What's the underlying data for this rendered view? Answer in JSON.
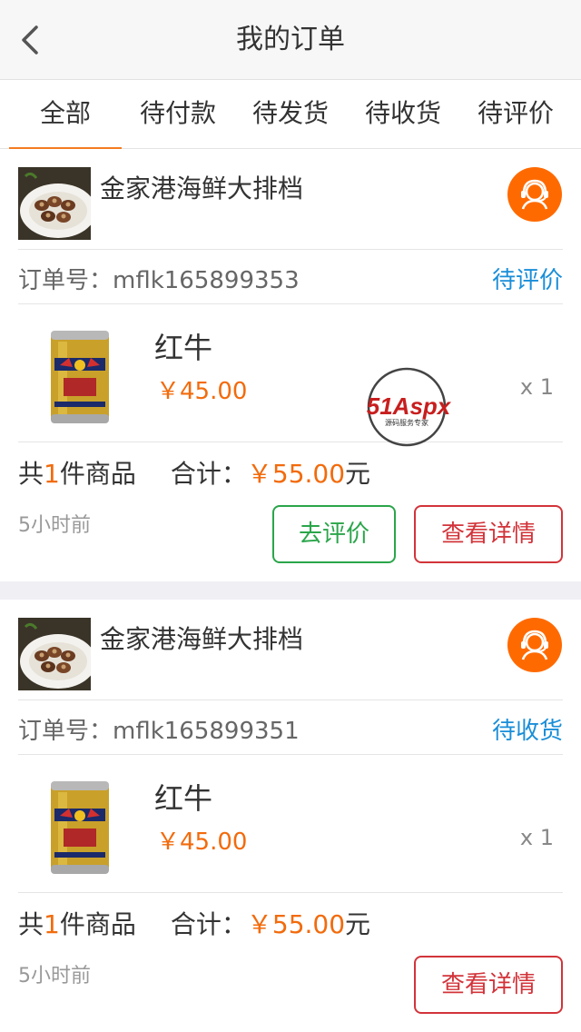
{
  "header": {
    "title": "我的订单",
    "back_icon": "chevron-left-icon"
  },
  "tabs": [
    {
      "label": "全部",
      "active": true
    },
    {
      "label": "待付款",
      "active": false
    },
    {
      "label": "待发货",
      "active": false
    },
    {
      "label": "待收货",
      "active": false
    },
    {
      "label": "待评价",
      "active": false
    }
  ],
  "orders": [
    {
      "shop_name": "金家港海鲜大排档",
      "order_no": "订单号：mflk165899353",
      "status": "待评价",
      "product": {
        "name": "红牛",
        "price": "￥45.00",
        "qty": "x 1"
      },
      "summary": {
        "prefix": "共",
        "count": "1",
        "suffix": "件商品",
        "total_label": "合计：",
        "total": "￥55.00",
        "unit": "元"
      },
      "time": "5小时前",
      "buttons": {
        "review": "去评价",
        "detail": "查看详情"
      }
    },
    {
      "shop_name": "金家港海鲜大排档",
      "order_no": "订单号：mflk165899351",
      "status": "待收货",
      "product": {
        "name": "红牛",
        "price": "￥45.00",
        "qty": "x 1"
      },
      "summary": {
        "prefix": "共",
        "count": "1",
        "suffix": "件商品",
        "total_label": "合计：",
        "total": "￥55.00",
        "unit": "元"
      },
      "time": "5小时前",
      "buttons": {
        "detail": "查看详情"
      }
    }
  ],
  "watermark": {
    "brand": "51Aspx",
    "tagline": "源码服务专家"
  },
  "colors": {
    "accent": "#f47c20",
    "price": "#f26b0c",
    "status": "#1a8ed8",
    "review_green": "#2aa54a",
    "detail_red": "#d2343a",
    "service_orange": "#ff6a00"
  }
}
